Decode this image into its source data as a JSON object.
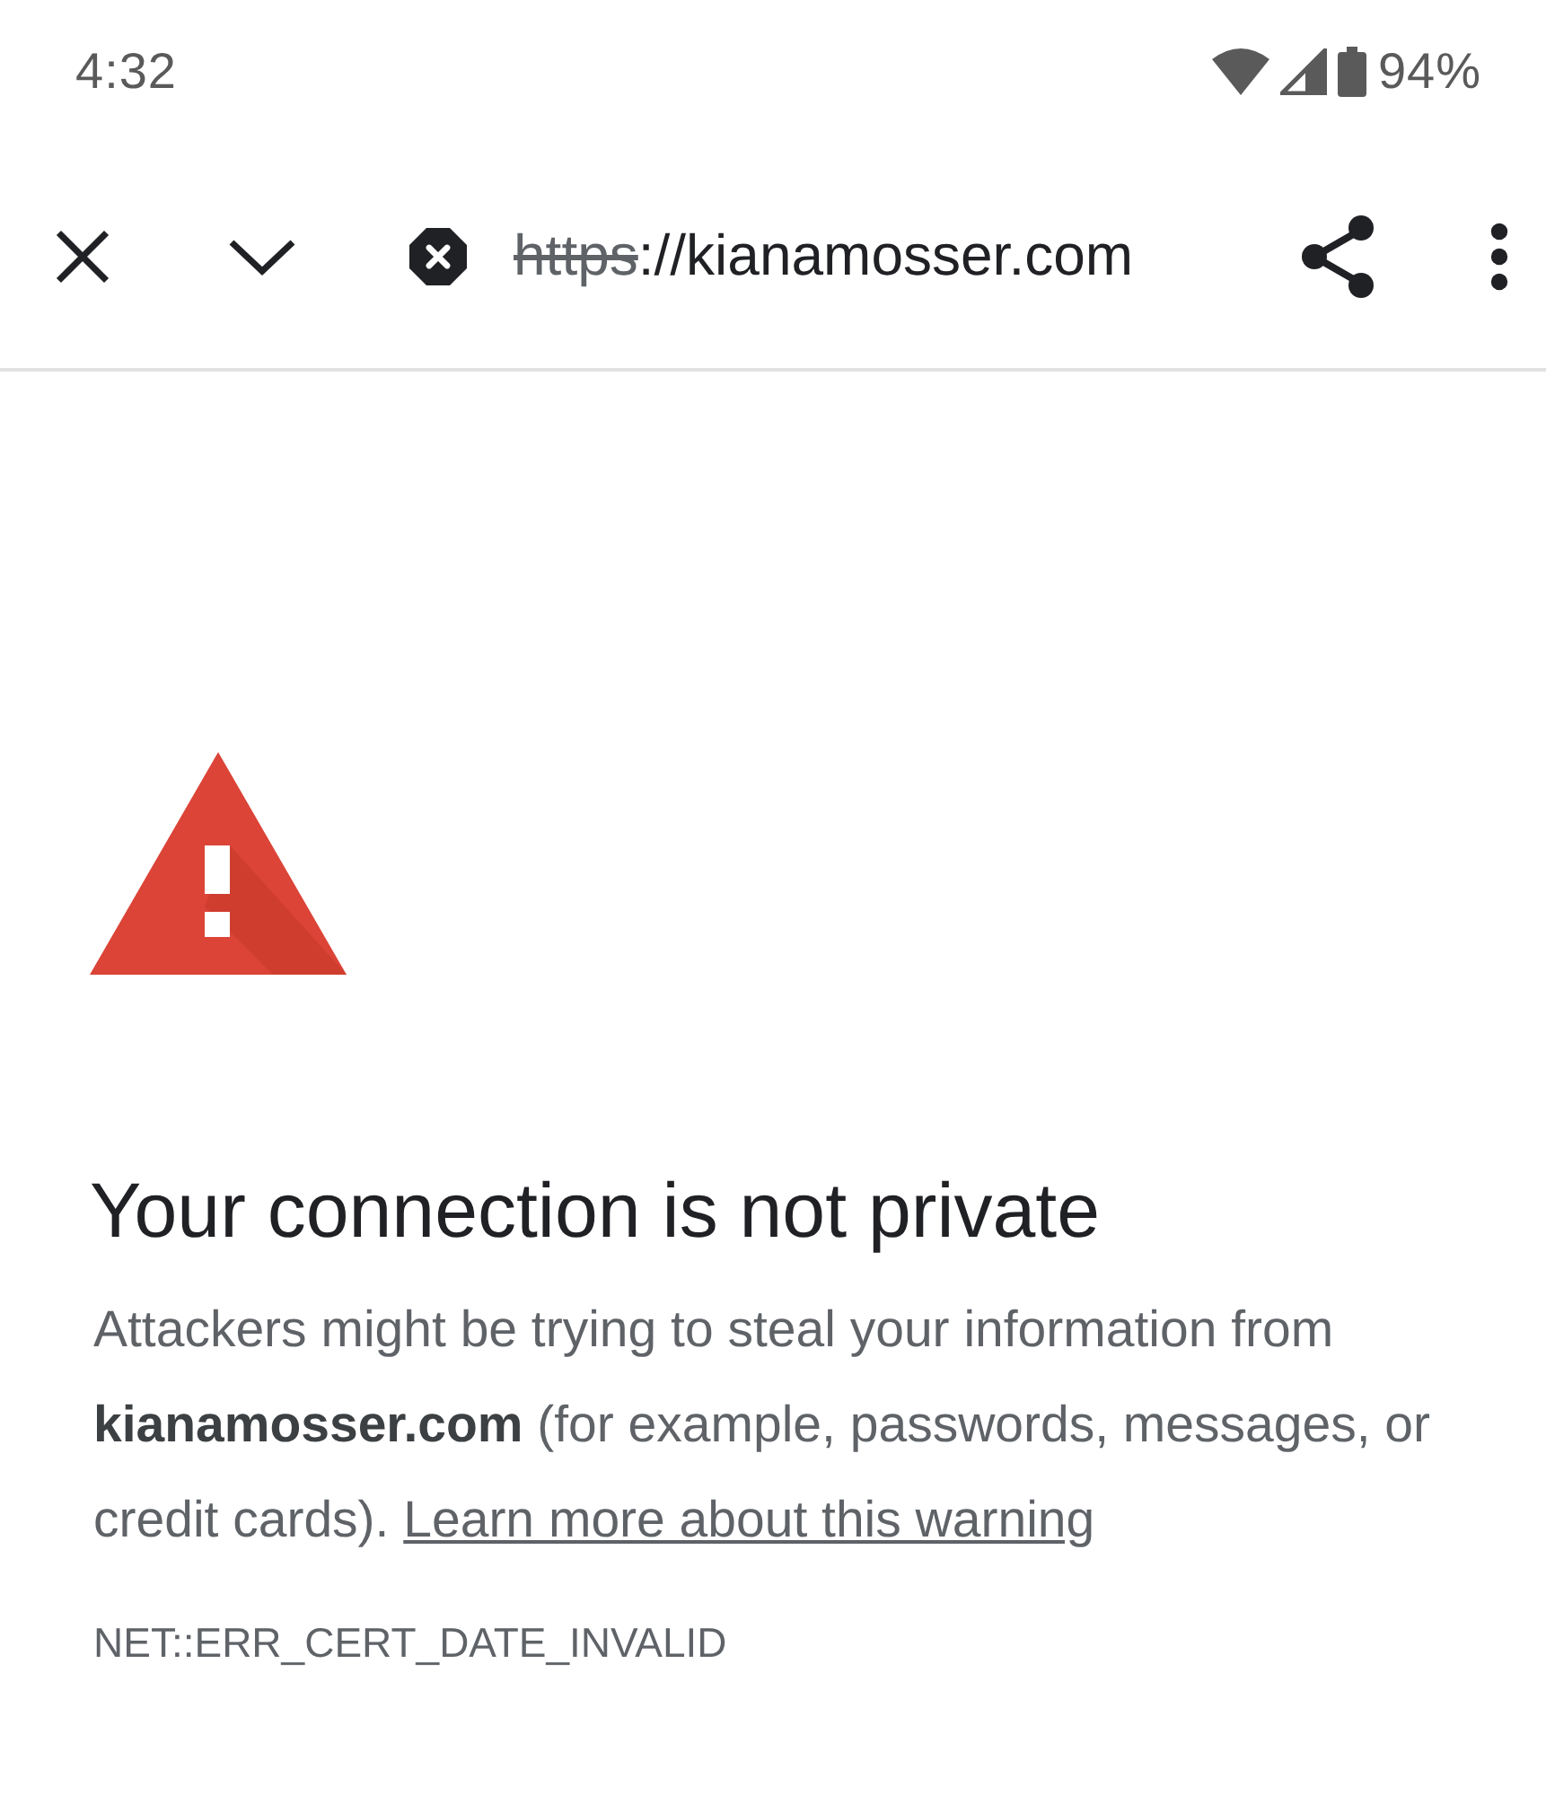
{
  "status_bar": {
    "time": "4:32",
    "battery": "94%"
  },
  "toolbar": {
    "url": {
      "scheme": "https",
      "scheme_struck": true,
      "rest": "://kianamosser.com"
    }
  },
  "warning": {
    "title": "Your connection is not private",
    "message": "Attackers might be trying to steal your information from **kianamosser.com** (for example, passwords, messages, or credit cards).",
    "link": "Learn more about this warning",
    "error_code": "NET::ERR_CERT_DATE_INVALID"
  }
}
